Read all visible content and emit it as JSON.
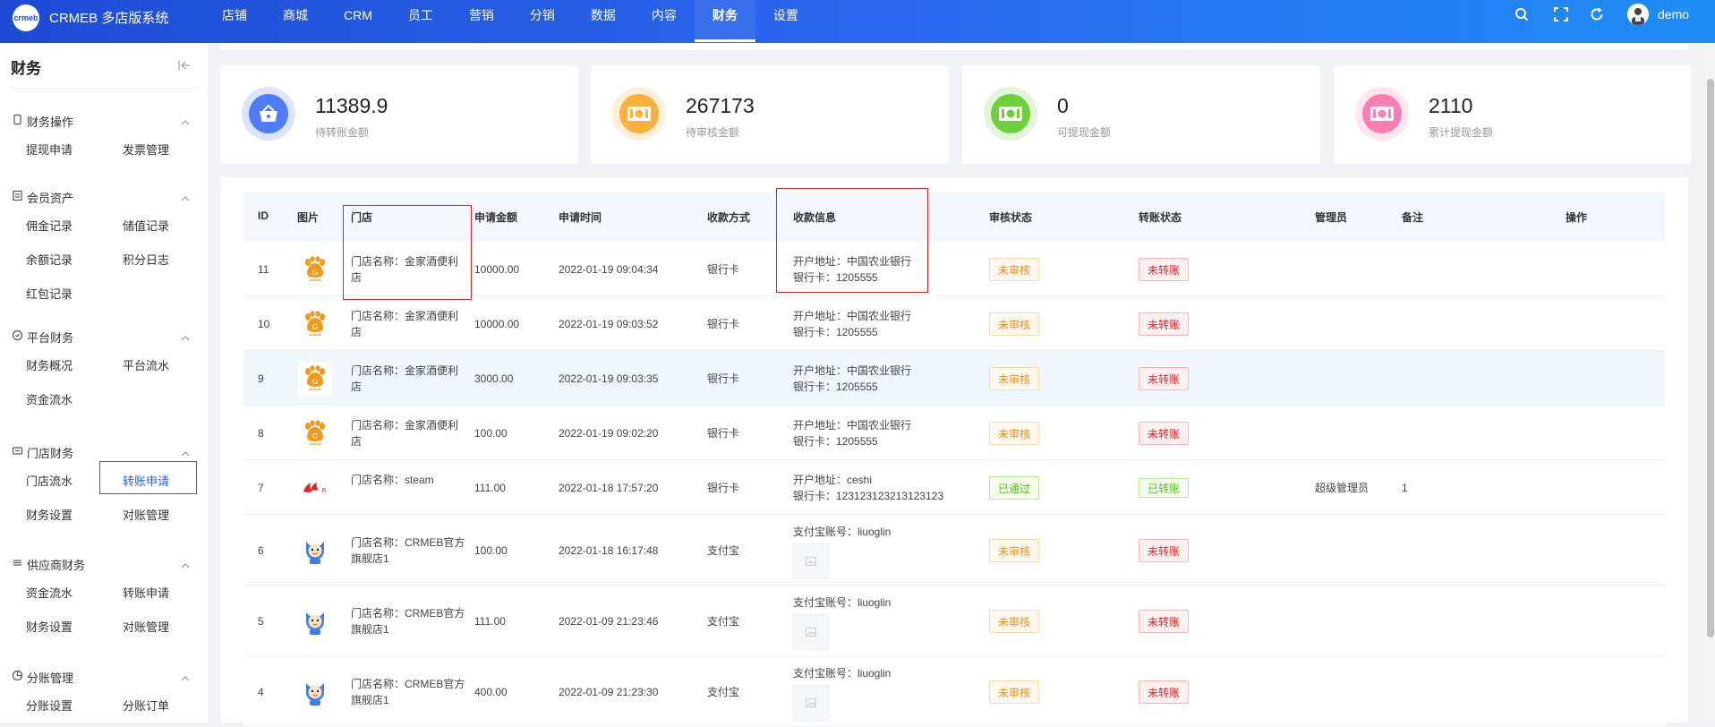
{
  "header": {
    "logo_text": "crmeb",
    "brand": "CRMEB 多店版系统",
    "nav": [
      "店铺",
      "商城",
      "CRM",
      "员工",
      "营销",
      "分销",
      "数据",
      "内容",
      "财务",
      "设置"
    ],
    "active_nav": "财务",
    "username": "demo"
  },
  "sidebar": {
    "title": "财务",
    "groups": [
      {
        "label": "财务操作",
        "items": [
          "提现申请",
          "发票管理"
        ]
      },
      {
        "label": "会员资产",
        "items": [
          "佣金记录",
          "储值记录",
          "余额记录",
          "积分日志",
          "红包记录"
        ]
      },
      {
        "label": "平台财务",
        "items": [
          "财务概况",
          "平台流水",
          "资金流水"
        ]
      },
      {
        "label": "门店财务",
        "items": [
          "门店流水",
          "转账申请",
          "财务设置",
          "对账管理"
        ]
      },
      {
        "label": "供应商财务",
        "items": [
          "资金流水",
          "转账申请",
          "财务设置",
          "对账管理"
        ]
      },
      {
        "label": "分账管理",
        "items": [
          "分账设置",
          "分账订单"
        ]
      }
    ],
    "active_item": "转账申请"
  },
  "stats": [
    {
      "value": "11389.9",
      "label": "待转账金额",
      "color": "#4e7cf6"
    },
    {
      "value": "267173",
      "label": "待审核金额",
      "color": "#fbb03b"
    },
    {
      "value": "0",
      "label": "可提现金额",
      "color": "#6fcf3a"
    },
    {
      "value": "2110",
      "label": "累计提现金额",
      "color": "#f97fb0"
    }
  ],
  "table": {
    "columns": [
      "ID",
      "图片",
      "门店",
      "申请金额",
      "申请时间",
      "收款方式",
      "收款信息",
      "审核状态",
      "转账状态",
      "管理员",
      "备注",
      "操作"
    ],
    "rows": [
      {
        "id": "11",
        "store": "门店名称：金家酒便利店",
        "amount": "10000.00",
        "time": "2022-01-19 09:04:34",
        "method": "银行卡",
        "info1": "开户地址：中国农业银行",
        "info2": "银行卡：1205555",
        "audit": "未审核",
        "transfer": "未转账",
        "admin": "",
        "remark": ""
      },
      {
        "id": "10",
        "store": "门店名称：金家酒便利店",
        "amount": "10000.00",
        "time": "2022-01-19 09:03:52",
        "method": "银行卡",
        "info1": "开户地址：中国农业银行",
        "info2": "银行卡：1205555",
        "audit": "未审核",
        "transfer": "未转账",
        "admin": "",
        "remark": ""
      },
      {
        "id": "9",
        "store": "门店名称：金家酒便利店",
        "amount": "3000.00",
        "time": "2022-01-19 09:03:35",
        "method": "银行卡",
        "info1": "开户地址：中国农业银行",
        "info2": "银行卡：1205555",
        "audit": "未审核",
        "transfer": "未转账",
        "admin": "",
        "remark": ""
      },
      {
        "id": "8",
        "store": "门店名称：金家酒便利店",
        "amount": "100.00",
        "time": "2022-01-19 09:02:20",
        "method": "银行卡",
        "info1": "开户地址：中国农业银行",
        "info2": "银行卡：1205555",
        "audit": "未审核",
        "transfer": "未转账",
        "admin": "",
        "remark": ""
      },
      {
        "id": "7",
        "store": "门店名称：steam",
        "amount": "111.00",
        "time": "2022-01-18 17:57:20",
        "method": "银行卡",
        "info1": "开户地址：ceshi",
        "info2": "银行卡：123123123213123123",
        "audit": "已通过",
        "transfer": "已转账",
        "admin": "超级管理员",
        "remark": "1"
      },
      {
        "id": "6",
        "store": "门店名称：CRMEB官方旗舰店1",
        "amount": "100.00",
        "time": "2022-01-18 16:17:48",
        "method": "支付宝",
        "info1": "支付宝账号：liuoglin",
        "info2": "",
        "audit": "未审核",
        "transfer": "未转账",
        "admin": "",
        "remark": ""
      },
      {
        "id": "5",
        "store": "门店名称：CRMEB官方旗舰店1",
        "amount": "111.00",
        "time": "2022-01-09 21:23:46",
        "method": "支付宝",
        "info1": "支付宝账号：liuoglin",
        "info2": "",
        "audit": "未审核",
        "transfer": "未转账",
        "admin": "",
        "remark": ""
      },
      {
        "id": "4",
        "store": "门店名称：CRMEB官方旗舰店1",
        "amount": "400.00",
        "time": "2022-01-09 21:23:30",
        "method": "支付宝",
        "info1": "支付宝账号：liuoglin",
        "info2": "",
        "audit": "未审核",
        "transfer": "未转账",
        "admin": "",
        "remark": ""
      }
    ]
  }
}
